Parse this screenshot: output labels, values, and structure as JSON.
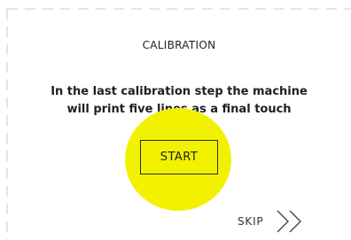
{
  "screen": {
    "title": "CALIBRATION",
    "message": "In the last calibration step the machine will print five lines as a final touch",
    "start_label": "START",
    "skip_label": "SKIP",
    "skip_icon": "double-chevron-right-icon"
  },
  "colors": {
    "background": "#ffffff",
    "text": "#1f1f1f",
    "highlight": "#f2f200",
    "dash_border": "#d6d6d6"
  }
}
